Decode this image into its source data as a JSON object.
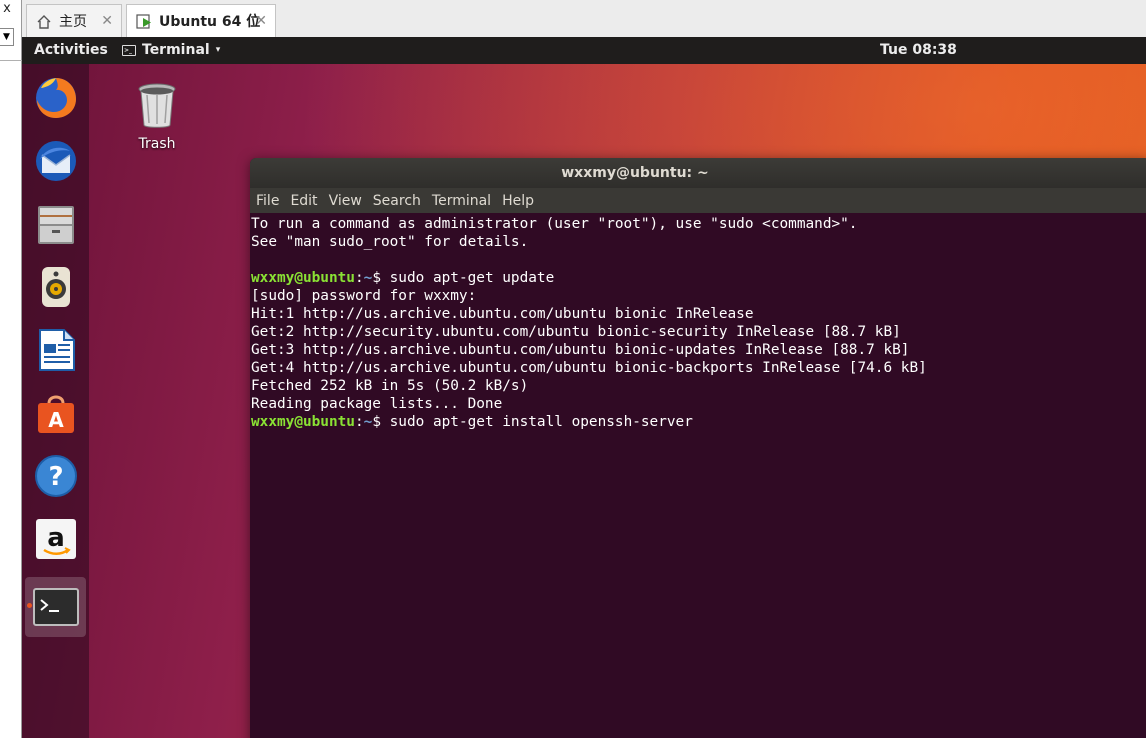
{
  "host": {
    "close_glyph": "x",
    "dropdown_glyph": "▼",
    "tabs": [
      {
        "label": "主页",
        "icon": "home-icon",
        "close": "✕"
      },
      {
        "label": "Ubuntu 64 位",
        "icon": "vm-play-icon",
        "close": "✕"
      }
    ]
  },
  "topbar": {
    "activities": "Activities",
    "app_name": "Terminal",
    "app_icon_text": ">_",
    "app_caret": "▾",
    "clock": "Tue 08:38"
  },
  "dock": {
    "items": [
      "firefox-icon",
      "thunderbird-icon",
      "files-icon",
      "rhythmbox-icon",
      "libreoffice-writer-icon",
      "ubuntu-software-icon",
      "help-icon",
      "amazon-icon",
      "terminal-icon"
    ],
    "active_item": "terminal-icon"
  },
  "desktop": {
    "trash_label": "Trash"
  },
  "terminal": {
    "title": "wxxmy@ubuntu: ~",
    "menu": [
      "File",
      "Edit",
      "View",
      "Search",
      "Terminal",
      "Help"
    ],
    "prompt_user": "wxxmy@ubuntu",
    "prompt_sep": ":",
    "prompt_path": "~",
    "prompt_symbol": "$ ",
    "lines": [
      {
        "text": "To run a command as administrator (user \"root\"), use \"sudo <command>\"."
      },
      {
        "text": "See \"man sudo_root\" for details."
      },
      {
        "text": ""
      },
      {
        "prompt": true,
        "text": "sudo apt-get update"
      },
      {
        "text": "[sudo] password for wxxmy:"
      },
      {
        "text": "Hit:1 http://us.archive.ubuntu.com/ubuntu bionic InRelease"
      },
      {
        "text": "Get:2 http://security.ubuntu.com/ubuntu bionic-security InRelease [88.7 kB]"
      },
      {
        "text": "Get:3 http://us.archive.ubuntu.com/ubuntu bionic-updates InRelease [88.7 kB]"
      },
      {
        "text": "Get:4 http://us.archive.ubuntu.com/ubuntu bionic-backports InRelease [74.6 kB]"
      },
      {
        "text": "Fetched 252 kB in 5s (50.2 kB/s)"
      },
      {
        "text": "Reading package lists... Done"
      },
      {
        "prompt": true,
        "text": "sudo apt-get install openssh-server"
      }
    ]
  },
  "colors": {
    "ubuntu_orange": "#e95420",
    "terminal_bg": "#300a24",
    "prompt_user": "#8ae234",
    "prompt_path": "#729fcf"
  }
}
